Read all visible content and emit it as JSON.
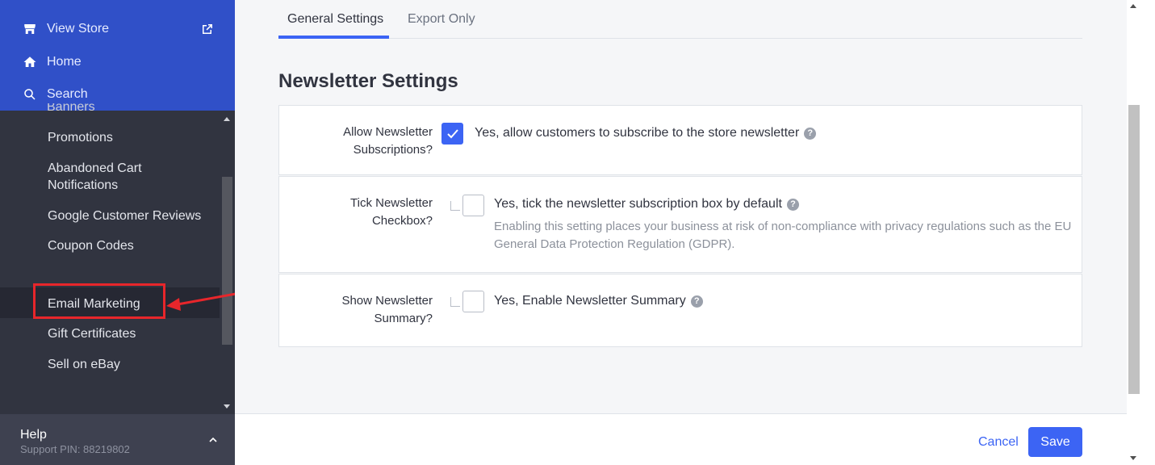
{
  "sidebar": {
    "top": {
      "view_store": "View Store",
      "home": "Home",
      "search": "Search"
    },
    "cut_off_item": "Banners",
    "items": [
      {
        "label": "Promotions"
      },
      {
        "label": "Abandoned Cart\nNotifications"
      },
      {
        "label": "Google Customer Reviews"
      },
      {
        "label": "Coupon Codes"
      },
      {
        "label": "Email Marketing"
      },
      {
        "label": "Gift Certificates"
      },
      {
        "label": "Sell on eBay"
      }
    ],
    "help": {
      "title": "Help",
      "pin": "Support PIN: 88219802"
    }
  },
  "tabs": [
    {
      "label": "General Settings"
    },
    {
      "label": "Export Only"
    }
  ],
  "section_title": "Newsletter Settings",
  "settings": [
    {
      "label": "Allow Newsletter\nSubscriptions?",
      "option": "Yes, allow customers to subscribe to the store newsletter",
      "checked": true
    },
    {
      "label": "Tick Newsletter\nCheckbox?",
      "option": "Yes, tick the newsletter subscription box by default",
      "description": "Enabling this setting places your business at risk of non-compliance with privacy regulations such as the EU General Data Protection Regulation (GDPR).",
      "checked": false
    },
    {
      "label": "Show Newsletter\nSummary?",
      "option": "Yes, Enable Newsletter Summary",
      "checked": false
    }
  ],
  "footer": {
    "cancel": "Cancel",
    "save": "Save"
  },
  "colors": {
    "accent": "#3c64f4",
    "sidebar_top": "#3050c8",
    "sidebar": "#313440",
    "annotation": "#e8262b"
  }
}
